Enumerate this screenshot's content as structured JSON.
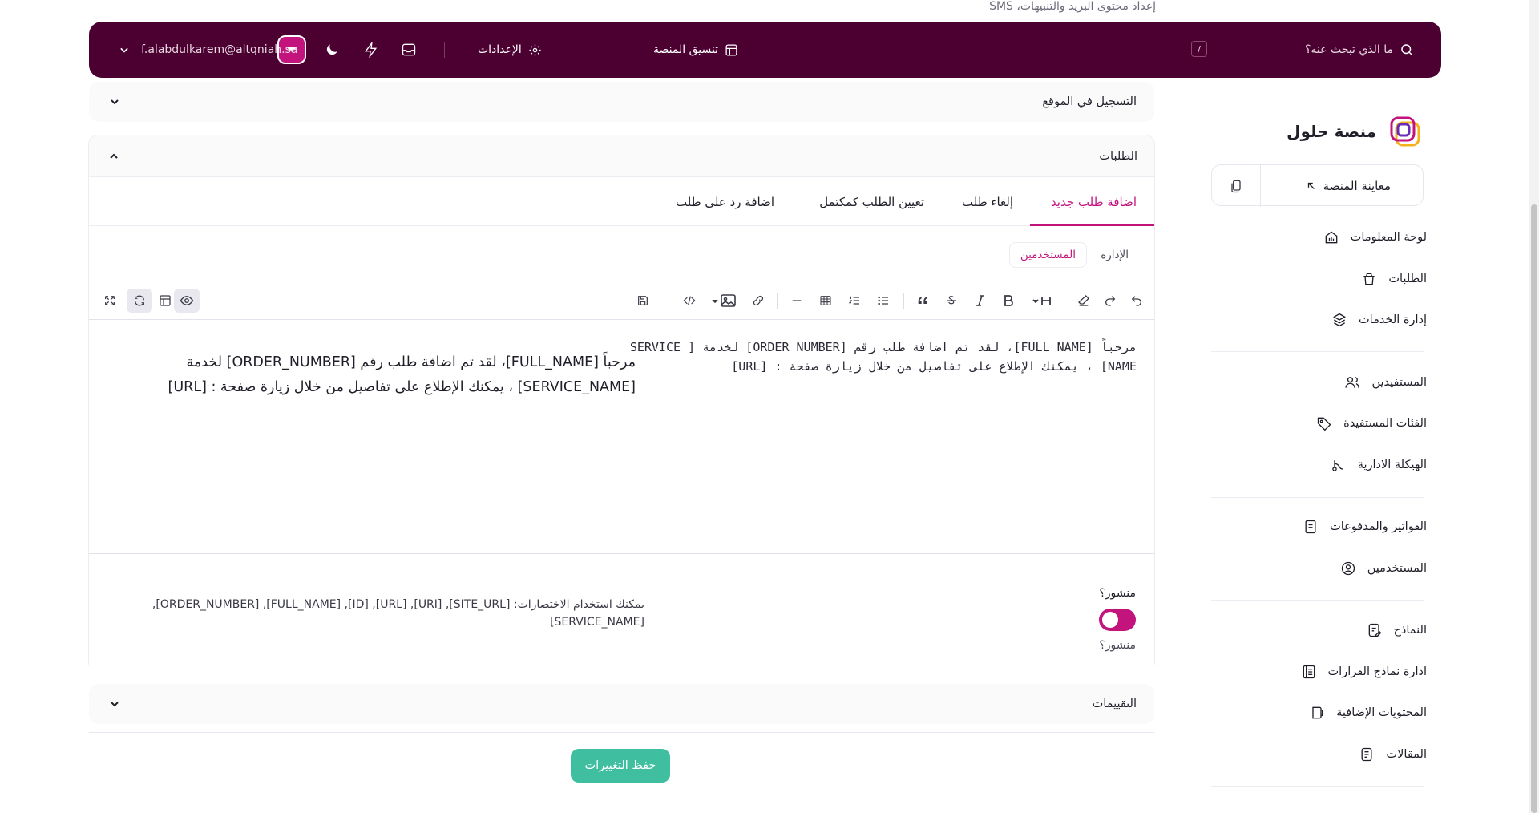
{
  "top_hint": "إعداد محتوى البريد والتنبيهات، SMS",
  "header": {
    "search_placeholder": "ما الذي تبحث عنه؟",
    "search_shortcut": "/",
    "nav_platform_layout": "تنسيق المنصة",
    "nav_settings": "الإعدادات",
    "user_email": "f.alabdulkarem@altqniah.sa"
  },
  "sidebar": {
    "brand_name": "منصة حلول",
    "preview_label": "معاينة المنصة",
    "items": [
      {
        "label": "لوحة المعلومات",
        "icon": "dashboard-icon"
      },
      {
        "label": "الطلبات",
        "icon": "orders-icon"
      },
      {
        "label": "إدارة الخدمات",
        "icon": "services-icon"
      },
      {
        "label": "المستفيدين",
        "icon": "beneficiaries-icon"
      },
      {
        "label": "الفئات المستفيدة",
        "icon": "tag-icon"
      },
      {
        "label": "الهيكلة الادارية",
        "icon": "structure-icon"
      },
      {
        "label": "الفواتير والمدفوعات",
        "icon": "invoice-icon"
      },
      {
        "label": "المستخدمين",
        "icon": "user-circle-icon"
      },
      {
        "label": "النماذج",
        "icon": "forms-icon"
      },
      {
        "label": "ادارة نماذج القرارات",
        "icon": "decision-templates-icon"
      },
      {
        "label": "المحتويات الإضافية",
        "icon": "extra-content-icon"
      },
      {
        "label": "المقالات",
        "icon": "articles-icon"
      }
    ]
  },
  "sections": {
    "registration": "التسجيل في الموقع",
    "orders": "الطلبات",
    "ratings": "التقييمات"
  },
  "tabs": [
    "اضافة طلب جديد",
    "إلغاء طلب",
    "تعيين الطلب كمكتمل",
    "اضافة رد على طلب"
  ],
  "subtabs": [
    "الإدارة",
    "المستخدمين"
  ],
  "editor": {
    "source_text": "مرحباً [FULL_NAME]، لقد تم اضافة طلب رقم [ORDER_NUMBER] لخدمة [SERVICE_NAME] ، يمكنك الإطلاع على تفاصيل من خلال زيارة صفحة : [URL]",
    "preview_text": "مرحباً [FULL_NAME]، لقد تم اضافة طلب رقم [ORDER_NUMBER] لخدمة [SERVICE_NAME] ، يمكنك الإطلاع على تفاصيل من خلال زيارة صفحة : [URL]"
  },
  "publish": {
    "label_top": "منشور؟",
    "label_bottom": "منشور؟",
    "enabled": true,
    "shortcut_hint": "يمكنك استخدام الاختصارات: [SITE_URL], [URI], [URL], [ID], [FULL_NAME], [ORDER_NUMBER], [SERVICE_NAME]"
  },
  "save_button": "حفظ التغييرات",
  "colors": {
    "header_bg": "#4b0031",
    "accent": "#c3147e",
    "save_button": "#3fbfa0"
  }
}
